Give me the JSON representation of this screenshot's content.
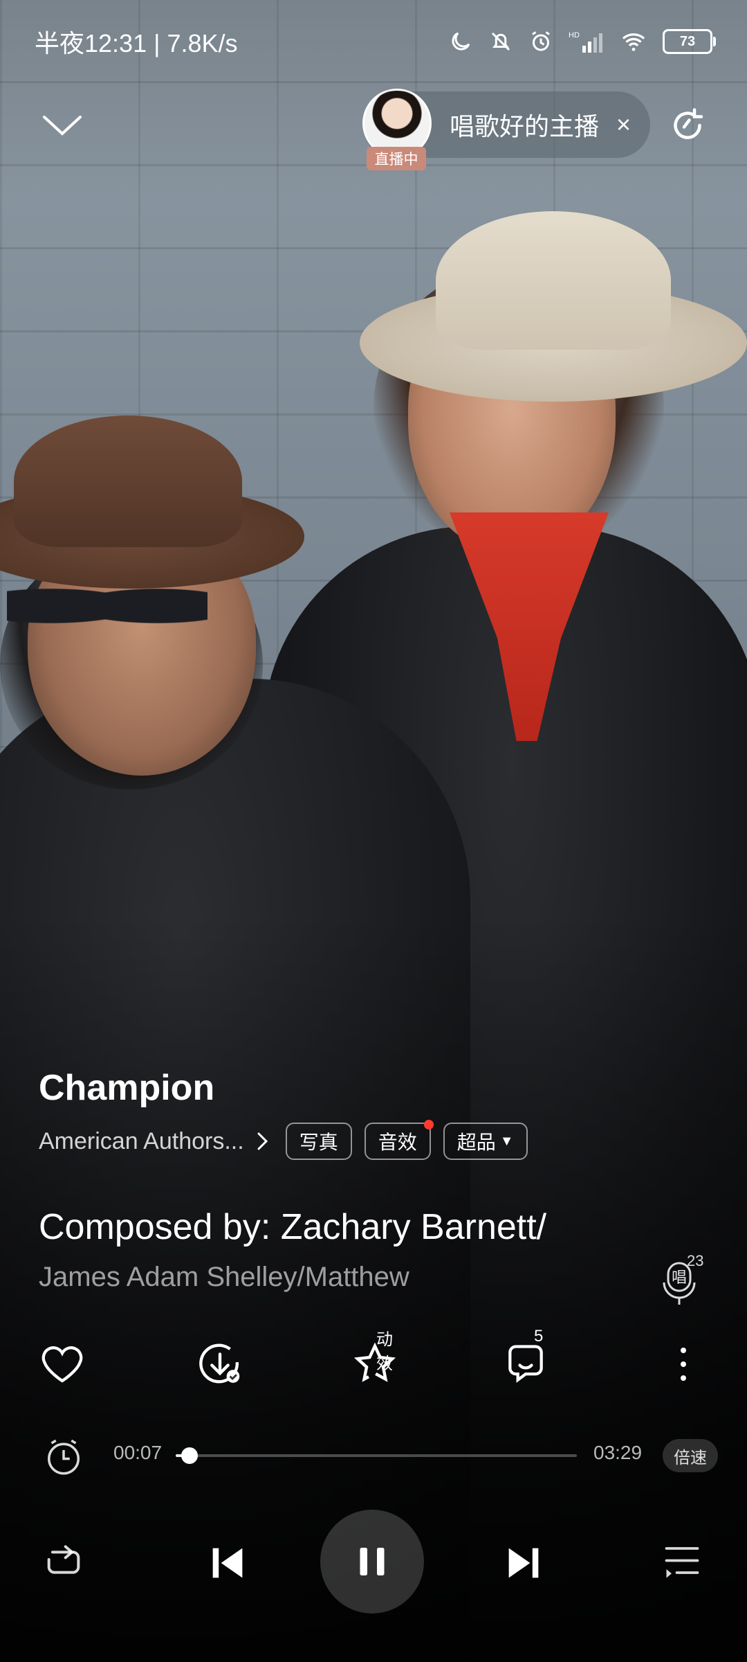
{
  "status_bar": {
    "time": "半夜12:31",
    "net_speed": "7.8K/s",
    "separator": "|",
    "battery": "73",
    "signal_label": "HD"
  },
  "live": {
    "name": "唱歌好的主播",
    "badge": "直播中",
    "close": "×"
  },
  "song": {
    "title": "Champion",
    "artist": "American Authors...",
    "tags": [
      {
        "label": "写真"
      },
      {
        "label": "音效"
      },
      {
        "label": "超品"
      }
    ]
  },
  "lyrics": {
    "line1": "Composed by:  Zachary Barnett/",
    "line2": "James Adam Shelley/Matthew"
  },
  "sing": {
    "label": "唱",
    "count": "23"
  },
  "actions": {
    "effects_label": "动效",
    "comments_count": "5"
  },
  "playback": {
    "current": "00:07",
    "total": "03:29",
    "progress_percent": 3.5,
    "speed_label": "倍速"
  },
  "colors": {
    "bandana": "#c92f22",
    "badge": "#c98a7a",
    "notification_dot": "#ff3b30"
  },
  "icons": [
    "collapse-chevron-icon",
    "refresh-icon",
    "heart-icon",
    "download-icon",
    "star-effects-icon",
    "comment-icon",
    "more-icon",
    "timer-icon",
    "repeat-icon",
    "previous-icon",
    "pause-icon",
    "next-icon",
    "playlist-icon",
    "mic-icon"
  ]
}
